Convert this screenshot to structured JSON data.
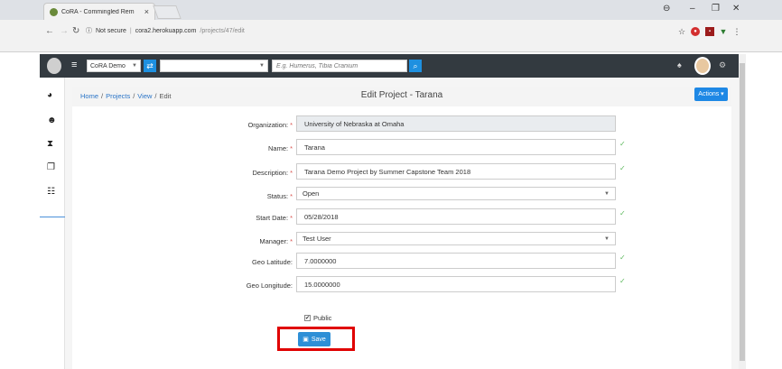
{
  "browser": {
    "tab_title": "CoRA - Commingled Rem",
    "tab_close": "×",
    "secure_label": "Not secure",
    "url_host": "cora2.herokuapp.com",
    "url_path": "/projects/47/edit",
    "win_minimize": "–",
    "win_restore": "❐",
    "win_close": "✕"
  },
  "appbar": {
    "project_select": "CoRA Demo",
    "search_placeholder": "E.g. Humerus, Tibia Cranium"
  },
  "breadcrumb": {
    "home": "Home",
    "projects": "Projects",
    "view": "View",
    "current": "Edit",
    "sep": "/"
  },
  "page_title": "Edit Project - Tarana",
  "actions_label": "Actions ▾",
  "form": {
    "organization": {
      "label": "Organization:",
      "value": "University of Nebraska at Omaha"
    },
    "name": {
      "label": "Name:",
      "value": "Tarana"
    },
    "description": {
      "label": "Description:",
      "value": "Tarana Demo Project by Summer Capstone Team 2018"
    },
    "status": {
      "label": "Status:",
      "value": "Open"
    },
    "start_date": {
      "label": "Start Date:",
      "value": "05/28/2018"
    },
    "manager": {
      "label": "Manager:",
      "value": "Test User"
    },
    "geo_latitude": {
      "label": "Geo Latitude:",
      "value": "7.0000000"
    },
    "geo_longitude": {
      "label": "Geo Longitude:",
      "value": "15.0000000"
    },
    "required_mark": "*",
    "valid_mark": "✓",
    "public_label": "Public",
    "save_label": "Save"
  },
  "colors": {
    "navbar": "#333a40",
    "accent": "#1e88e5",
    "highlight": "#e00000"
  }
}
